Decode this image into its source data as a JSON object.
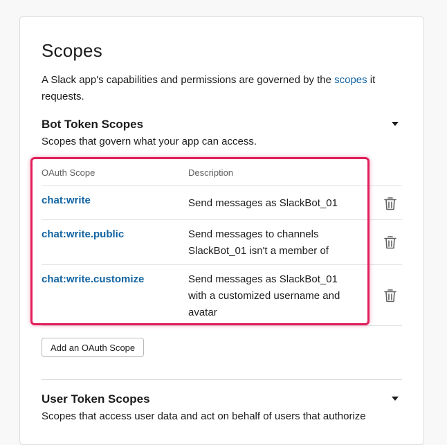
{
  "page": {
    "title": "Scopes",
    "intro_before_link": "A Slack app's capabilities and permissions are governed by the ",
    "intro_link": "scopes",
    "intro_after_link": " it requests."
  },
  "bot_section": {
    "title": "Bot Token Scopes",
    "subtitle": "Scopes that govern what your app can access.",
    "table_headers": {
      "scope": "OAuth Scope",
      "description": "Description"
    },
    "scopes": [
      {
        "name": "chat:write",
        "description": "Send messages as SlackBot_01"
      },
      {
        "name": "chat:write.public",
        "description": "Send messages to channels SlackBot_01 isn't a member of"
      },
      {
        "name": "chat:write.customize",
        "description": "Send messages as SlackBot_01 with a customized username and avatar"
      }
    ],
    "add_button_label": "Add an OAuth Scope",
    "row_action_icon": "trash-icon"
  },
  "user_section": {
    "title": "User Token Scopes",
    "subtitle": "Scopes that access user data and act on behalf of users that authorize"
  },
  "colors": {
    "link": "#1264a3",
    "highlight": "#e11d5b",
    "text": "#1d1c1d"
  }
}
